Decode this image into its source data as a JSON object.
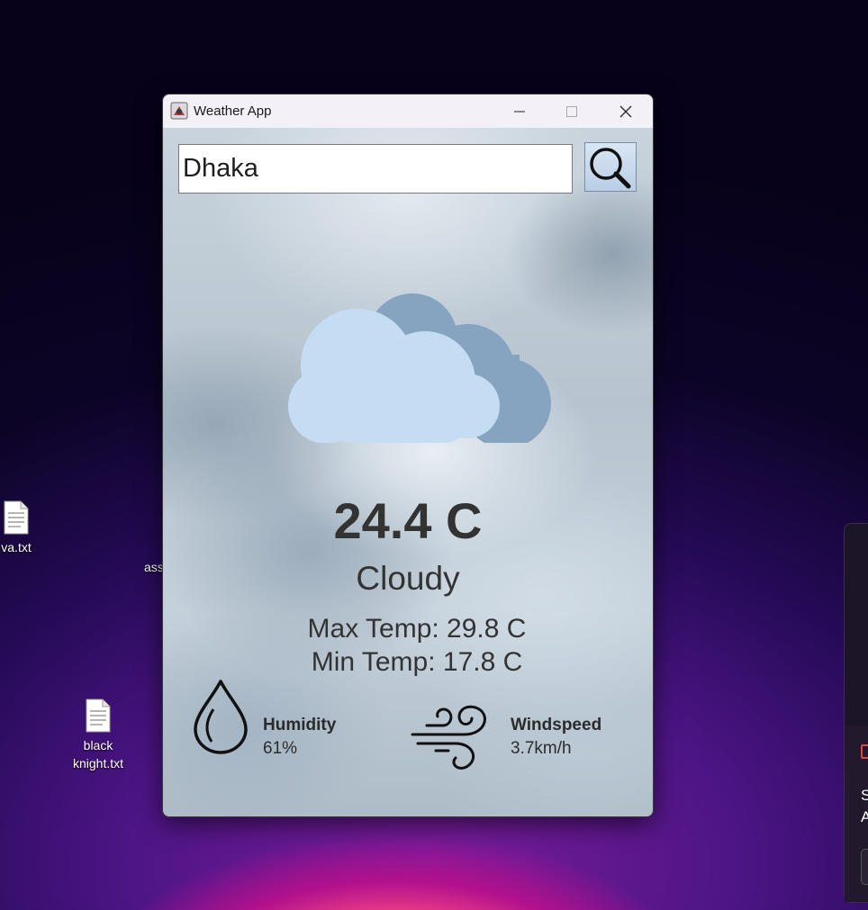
{
  "desktop": {
    "icons": [
      {
        "label_line1": "va.txt",
        "label_line2": ""
      },
      {
        "label_line1": "black",
        "label_line2": "knight.txt"
      }
    ],
    "partial_label": "ass"
  },
  "notification": {
    "line1": "S",
    "line2": "A"
  },
  "window": {
    "title": "Weather App",
    "controls": {
      "minimize": "—",
      "maximize": "☐",
      "close": "✕"
    }
  },
  "search": {
    "value": "Dhaka",
    "button_icon": "magnifier-icon"
  },
  "weather": {
    "condition_icon": "cloudy-icon",
    "temperature": "24.4 C",
    "description": "Cloudy",
    "max_temp": "Max Temp: 29.8 C",
    "min_temp": "Min Temp: 17.8 C"
  },
  "humidity": {
    "label": "Humidity",
    "value": "61%",
    "icon": "humidity-drop-icon"
  },
  "windspeed": {
    "label": "Windspeed",
    "value": "3.7km/h",
    "icon": "wind-icon"
  },
  "colors": {
    "cloud_front": "#c5ddf3",
    "cloud_back": "#86a3c0",
    "text": "#333333"
  }
}
